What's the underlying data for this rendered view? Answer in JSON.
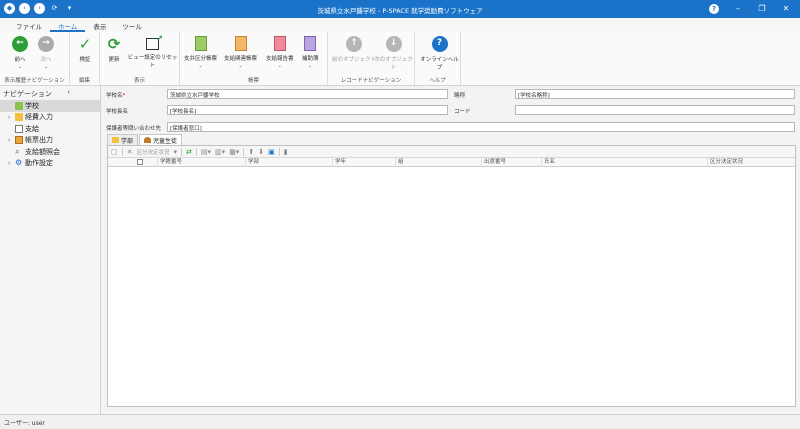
{
  "titlebar": {
    "title": "茨城県立水戸聾学校 - P-SPACE 就学奨励費ソフトウェア",
    "help": "?"
  },
  "menu": {
    "tabs": [
      "ファイル",
      "ホーム",
      "表示",
      "ツール"
    ]
  },
  "ribbon": {
    "nav_group": "表示履歴ナビゲーション",
    "back": "前へ",
    "forward": "次へ",
    "edit_group": "編集",
    "verify": "検証",
    "view_group": "表示",
    "refresh": "更新",
    "view_reset": "ビュー設定のリセット",
    "forms_group": "帳票",
    "form1": "支弁区分帳票",
    "form2": "支給関連帳票",
    "form3": "支給報告書",
    "form4": "補助簿",
    "record_group": "レコードナビゲーション",
    "prev_obj": "前のオブジェクト",
    "next_obj": "次のオブジェクト",
    "help_group": "ヘルプ",
    "online_help": "オンラインヘルプ"
  },
  "navigation": {
    "title": "ナビゲーション",
    "items": [
      {
        "label": "学校",
        "expandable": false,
        "selected": true
      },
      {
        "label": "経費入力",
        "expandable": true,
        "selected": false
      },
      {
        "label": "支給",
        "expandable": false,
        "selected": false
      },
      {
        "label": "帳票出力",
        "expandable": true,
        "selected": false
      },
      {
        "label": "支給額照会",
        "expandable": false,
        "selected": false
      },
      {
        "label": "動作設定",
        "expandable": true,
        "selected": false
      }
    ]
  },
  "form": {
    "school_name_label": "学校名",
    "school_name_value": "茨城県立水戸聾学校",
    "abbr_label": "略称",
    "abbr_value": "[学校名略称]",
    "principal_label": "学校長名",
    "principal_value": "[学校長名]",
    "code_label": "コード",
    "code_value": "",
    "contact_label": "保護者等問い合わせ先",
    "contact_value": "[保護者窓口]"
  },
  "subtabs": [
    "学部",
    "児童生徒"
  ],
  "grid": {
    "toolbar_filter": "区分決定状況",
    "columns": [
      "学籍番号",
      "学部",
      "学年",
      "組",
      "出席番号",
      "氏名",
      "区分決定状況"
    ]
  },
  "status": {
    "user": "ユーザー: user"
  },
  "colors": {
    "accent": "#1a73c8",
    "green": "#2e9e3a",
    "orange": "#e8a33a"
  }
}
